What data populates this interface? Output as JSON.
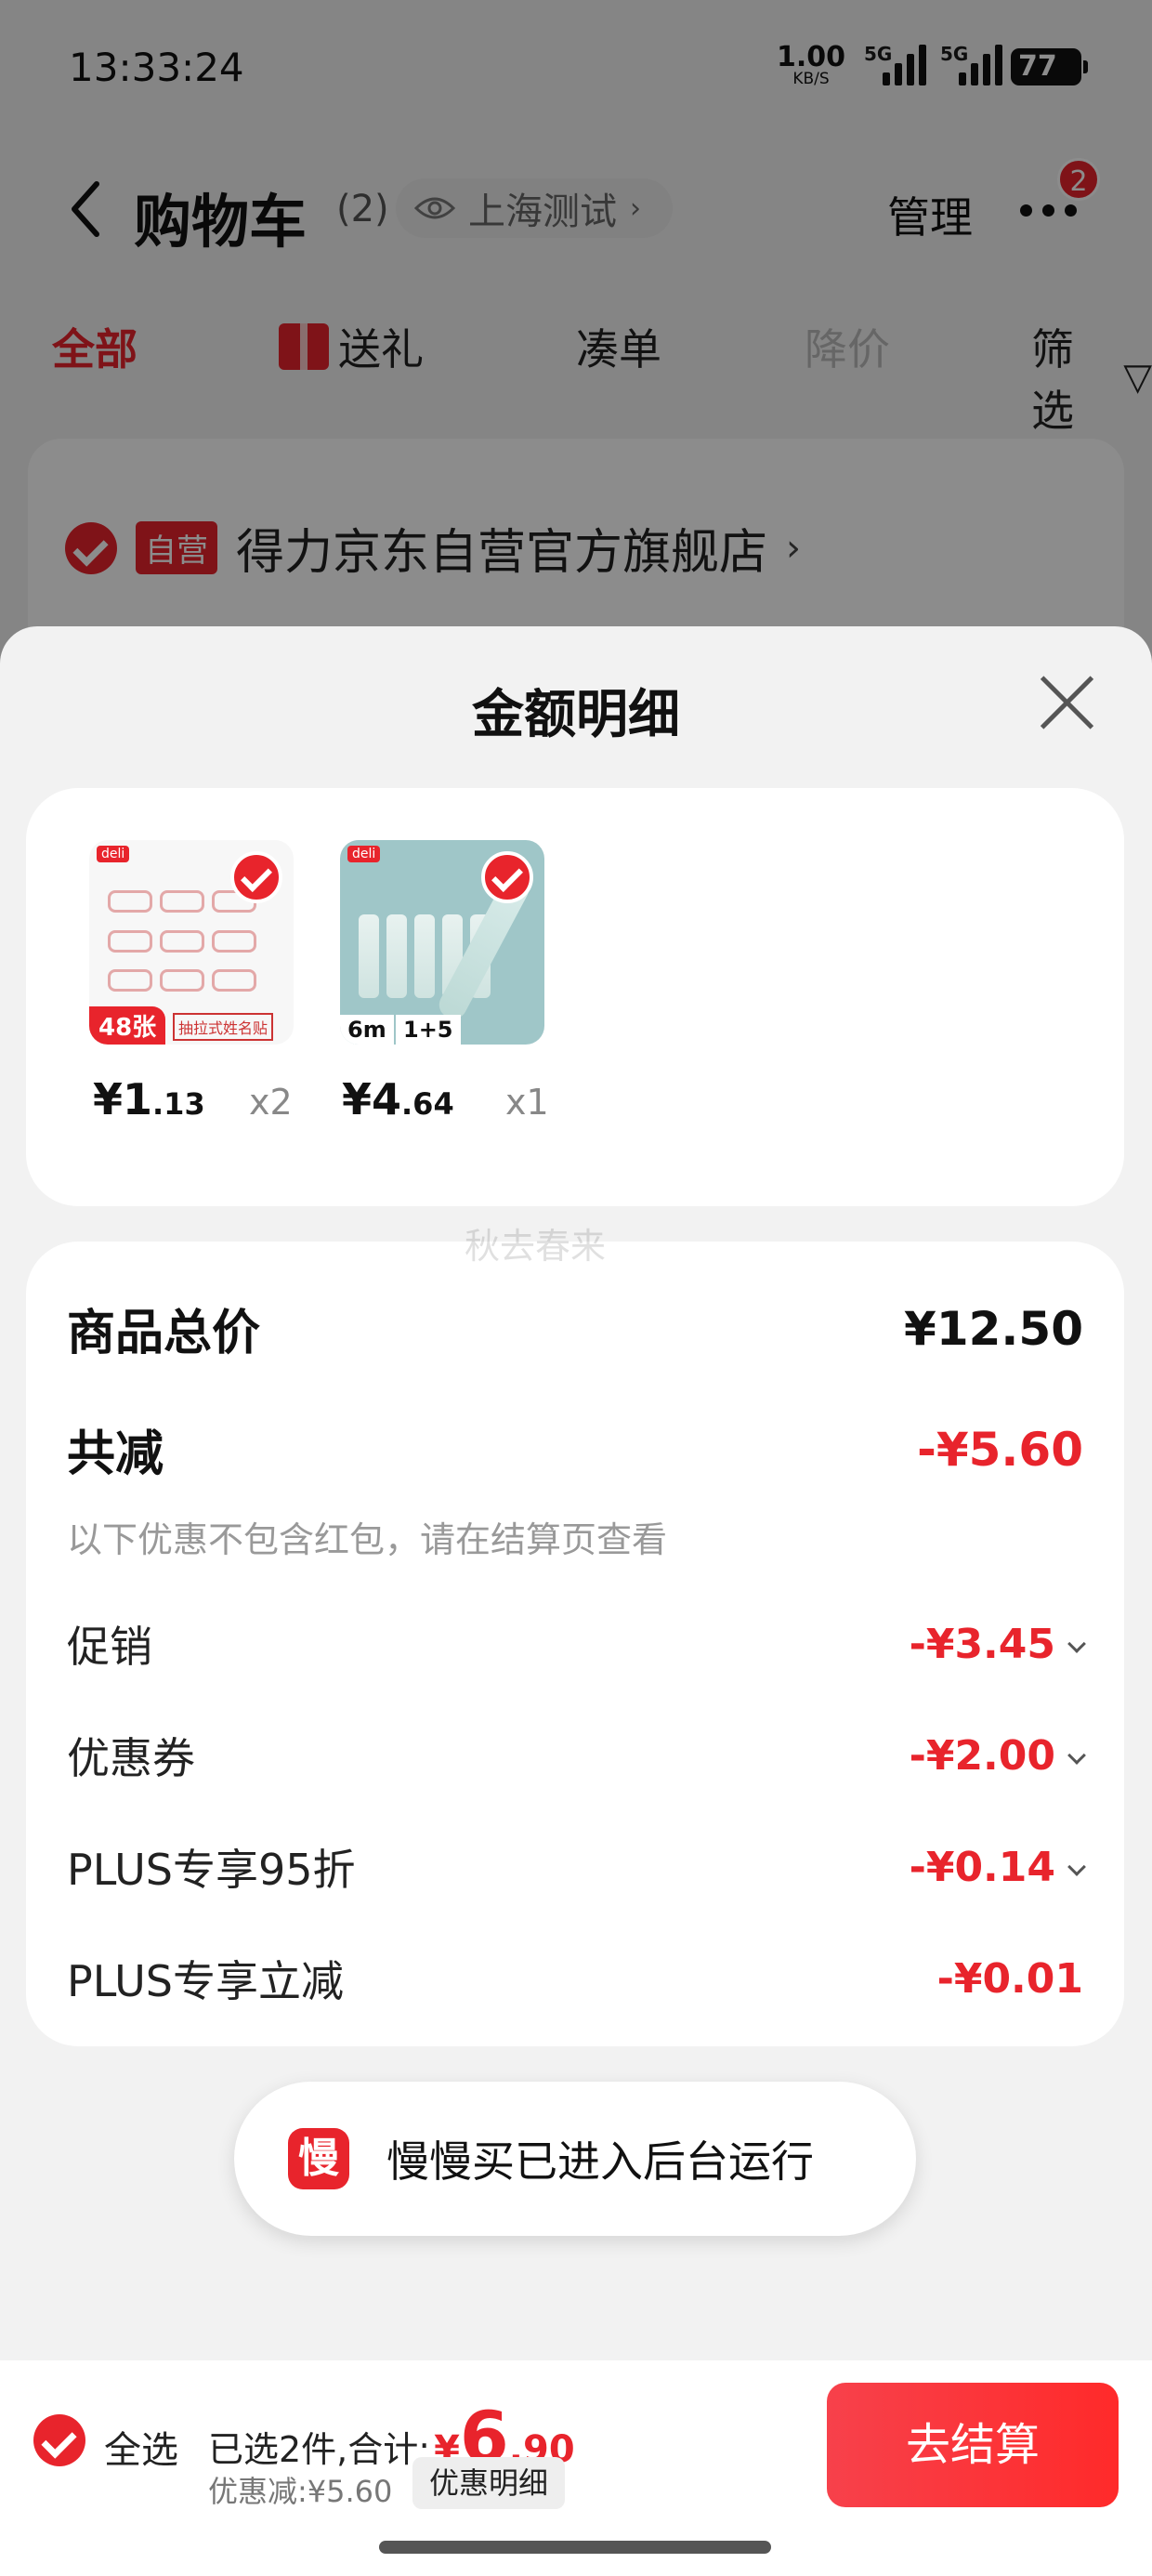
{
  "status_bar": {
    "time": "13:33:24",
    "speed_value": "1.00",
    "speed_unit": "KB/S",
    "network1": "5G",
    "network2": "5G",
    "battery": "77"
  },
  "header": {
    "title": "购物车",
    "count": "(2)",
    "location": "上海测试",
    "manage": "管理",
    "more_badge": "2"
  },
  "tabs": [
    {
      "label": "全部"
    },
    {
      "label": "送礼"
    },
    {
      "label": "凑单"
    },
    {
      "label": "降价"
    },
    {
      "label": "筛选"
    }
  ],
  "store": {
    "tag": "自营",
    "name": "得力京东自营官方旗舰店"
  },
  "sheet": {
    "title": "金额明细",
    "products": [
      {
        "price_int": "¥1",
        "price_dec": ".13",
        "qty": "x2",
        "pack": "48张",
        "deli": "deli",
        "caption": "抽拉式姓名贴"
      },
      {
        "price_int": "¥4",
        "price_dec": ".64",
        "qty": "x1",
        "deli": "deli",
        "badge_a": "6m",
        "badge_b": "1+5"
      }
    ],
    "watermark": "秋去春来",
    "total_label": "商品总价",
    "total_value": "¥12.50",
    "reduce_label": "共减",
    "reduce_value": "-¥5.60",
    "note": "以下优惠不包含红包，请在结算页查看",
    "items": [
      {
        "label": "促销",
        "value": "-¥3.45"
      },
      {
        "label": "优惠券",
        "value": "-¥2.00"
      },
      {
        "label": "PLUS专享95折",
        "value": "-¥0.14"
      },
      {
        "label": "PLUS专享立减",
        "value": "-¥0.01"
      }
    ]
  },
  "toast": {
    "icon_text": "慢",
    "text": "慢慢买已进入后台运行"
  },
  "bottom": {
    "select_all": "全选",
    "selected": "已选2件,合计:",
    "currency": "¥",
    "amount_int": "6",
    "amount_dec": ".90",
    "discount": "优惠减:¥5.60",
    "detail_btn": "优惠明细",
    "checkout": "去结算"
  },
  "colors": {
    "accent": "#e8242c",
    "background": "#f2f2f2"
  }
}
